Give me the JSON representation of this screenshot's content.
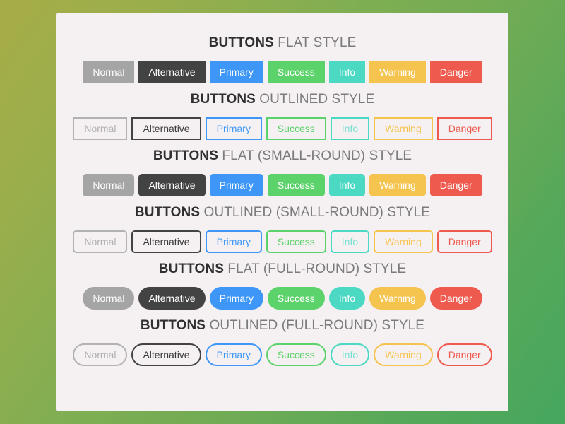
{
  "page": {
    "background_gradient_from": "#a7ad47",
    "background_gradient_to": "#46a75e",
    "card_background": "#f5f0f1"
  },
  "palette": {
    "normal": "#a5a5a5",
    "alternative": "#434343",
    "primary": "#3e97f7",
    "success": "#5cd26b",
    "info": "#4bd9c4",
    "warning": "#f5c44f",
    "danger": "#ef5a4f"
  },
  "button_labels": {
    "normal": "Normal",
    "alternative": "Alternative",
    "primary": "Primary",
    "success": "Success",
    "info": "Info",
    "warning": "Warning",
    "danger": "Danger"
  },
  "sections": [
    {
      "title_strong": "BUTTONS",
      "title_rest": " FLAT STYLE",
      "style": "flat",
      "radius": "square",
      "buttons": [
        {
          "label": "Normal",
          "variant": "normal"
        },
        {
          "label": "Alternative",
          "variant": "alternative"
        },
        {
          "label": "Primary",
          "variant": "primary"
        },
        {
          "label": "Success",
          "variant": "success"
        },
        {
          "label": "Info",
          "variant": "info"
        },
        {
          "label": "Warning",
          "variant": "warning"
        },
        {
          "label": "Danger",
          "variant": "danger"
        }
      ]
    },
    {
      "title_strong": "BUTTONS",
      "title_rest": " OUTLINED STYLE",
      "style": "outlined",
      "radius": "square",
      "buttons": [
        {
          "label": "Normal",
          "variant": "normal"
        },
        {
          "label": "Alternative",
          "variant": "alternative"
        },
        {
          "label": "Primary",
          "variant": "primary"
        },
        {
          "label": "Success",
          "variant": "success"
        },
        {
          "label": "Info",
          "variant": "info"
        },
        {
          "label": "Warning",
          "variant": "warning"
        },
        {
          "label": "Danger",
          "variant": "danger"
        }
      ]
    },
    {
      "title_strong": "BUTTONS",
      "title_rest": " FLAT (SMALL-ROUND) STYLE",
      "style": "flat",
      "radius": "small",
      "buttons": [
        {
          "label": "Normal",
          "variant": "normal"
        },
        {
          "label": "Alternative",
          "variant": "alternative"
        },
        {
          "label": "Primary",
          "variant": "primary"
        },
        {
          "label": "Success",
          "variant": "success"
        },
        {
          "label": "Info",
          "variant": "info"
        },
        {
          "label": "Warning",
          "variant": "warning"
        },
        {
          "label": "Danger",
          "variant": "danger"
        }
      ]
    },
    {
      "title_strong": "BUTTONS",
      "title_rest": " OUTLINED (SMALL-ROUND) STYLE",
      "style": "outlined",
      "radius": "small",
      "buttons": [
        {
          "label": "Normal",
          "variant": "normal"
        },
        {
          "label": "Alternative",
          "variant": "alternative"
        },
        {
          "label": "Primary",
          "variant": "primary"
        },
        {
          "label": "Success",
          "variant": "success"
        },
        {
          "label": "Info",
          "variant": "info"
        },
        {
          "label": "Warning",
          "variant": "warning"
        },
        {
          "label": "Danger",
          "variant": "danger"
        }
      ]
    },
    {
      "title_strong": "BUTTONS",
      "title_rest": " FLAT (FULL-ROUND) STYLE",
      "style": "flat",
      "radius": "full",
      "buttons": [
        {
          "label": "Normal",
          "variant": "normal"
        },
        {
          "label": "Alternative",
          "variant": "alternative"
        },
        {
          "label": "Primary",
          "variant": "primary"
        },
        {
          "label": "Success",
          "variant": "success"
        },
        {
          "label": "Info",
          "variant": "info"
        },
        {
          "label": "Warning",
          "variant": "warning"
        },
        {
          "label": "Danger",
          "variant": "danger"
        }
      ]
    },
    {
      "title_strong": "BUTTONS",
      "title_rest": " OUTLINED (FULL-ROUND) STYLE",
      "style": "outlined",
      "radius": "full",
      "buttons": [
        {
          "label": "Normal",
          "variant": "normal"
        },
        {
          "label": "Alternative",
          "variant": "alternative"
        },
        {
          "label": "Primary",
          "variant": "primary"
        },
        {
          "label": "Success",
          "variant": "success"
        },
        {
          "label": "Info",
          "variant": "info"
        },
        {
          "label": "Warning",
          "variant": "warning"
        },
        {
          "label": "Danger",
          "variant": "danger"
        }
      ]
    }
  ]
}
